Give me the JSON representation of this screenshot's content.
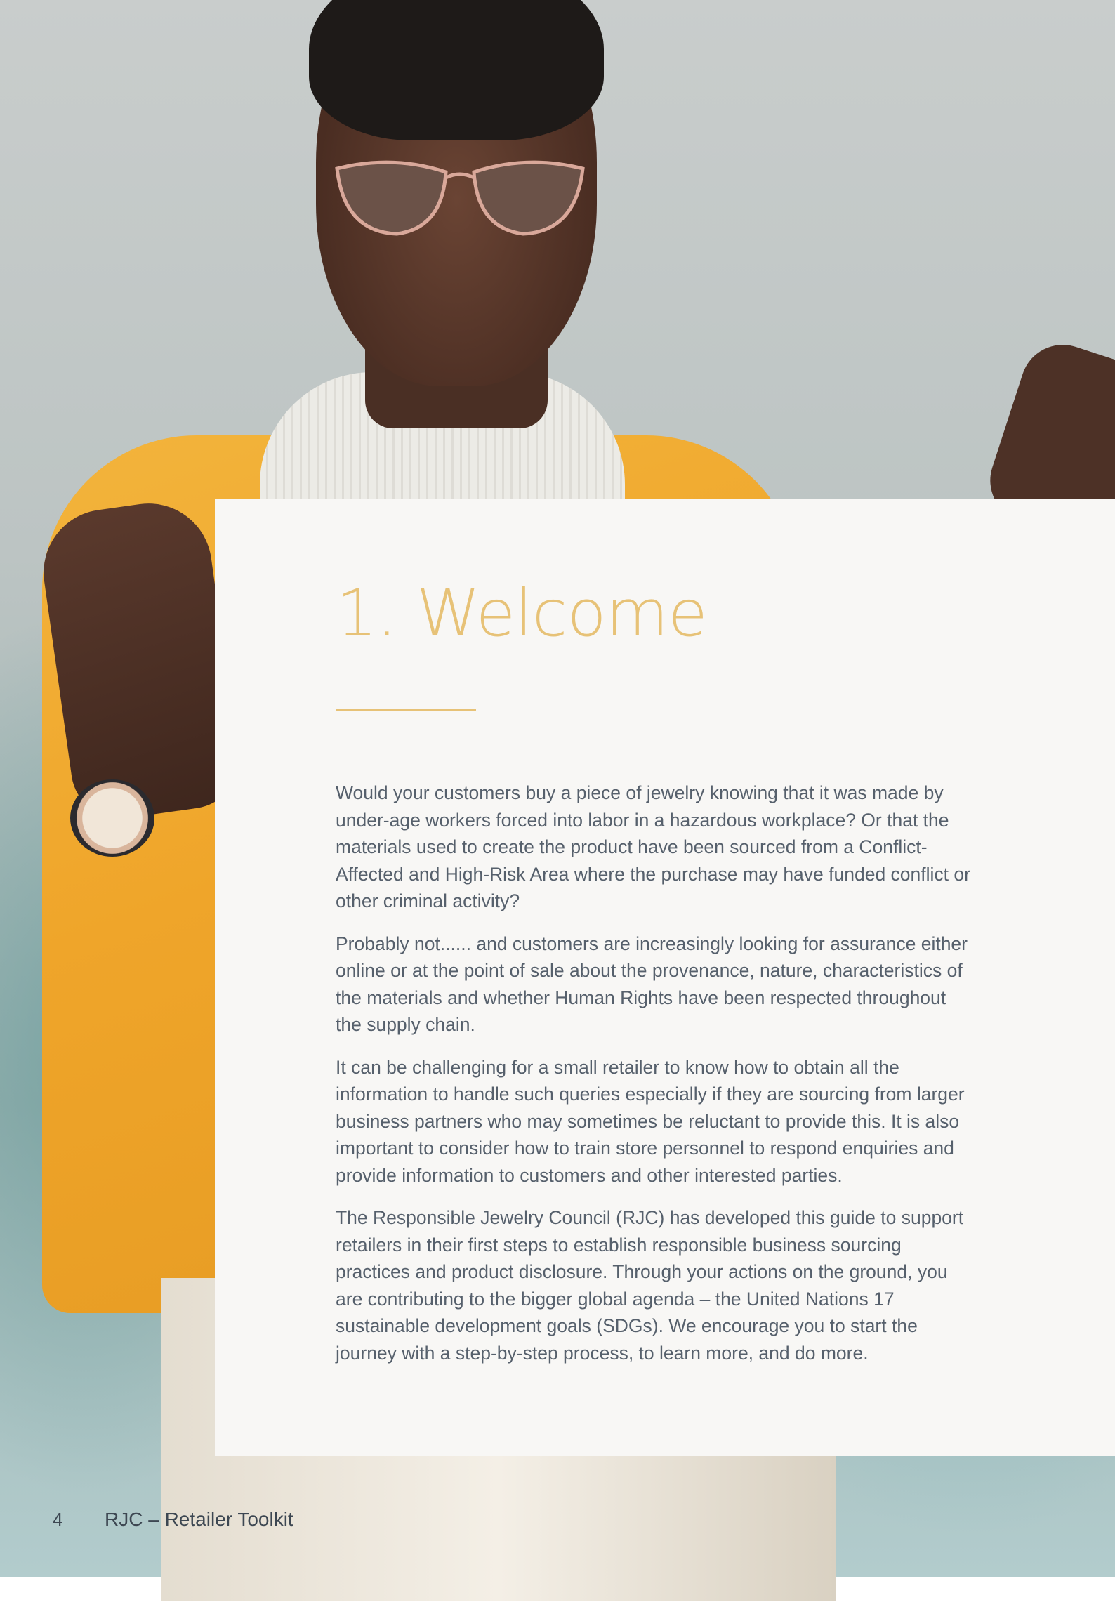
{
  "page": {
    "title": "1. Welcome",
    "paragraphs": [
      "Would your customers buy a piece of jewelry knowing that it was made by under-age workers forced into labor in a hazardous workplace? Or that the materials used to create the product have been sourced from a Conflict-Affected and High-Risk Area where the purchase may have funded conflict or other criminal activity?",
      "Probably not...... and customers are increasingly looking for assurance either online or at the point of sale about the provenance, nature, characteristics of the materials and whether Human Rights have been respected throughout the supply chain.",
      "It can be challenging for a small retailer to know how to obtain all the information to handle such queries especially if they are sourcing from larger business partners who may sometimes be reluctant to provide this. It is also important to consider how to train store personnel to respond enquiries and provide information to customers and other interested parties.",
      "The Responsible Jewelry Council (RJC) has developed this guide to support retailers in their first steps to establish responsible business sourcing practices and product disclosure. Through your actions on the ground, you are contributing to the bigger global agenda – the United Nations 17 sustainable development goals (SDGs). We encourage you to start the journey with a step-by-step process, to learn more, and do more."
    ]
  },
  "footer": {
    "page_number": "4",
    "document_title": "RJC – Retailer Toolkit"
  },
  "colors": {
    "accent": "#e7c277",
    "body_text": "#56606c",
    "card_background": "#f8f7f5"
  }
}
